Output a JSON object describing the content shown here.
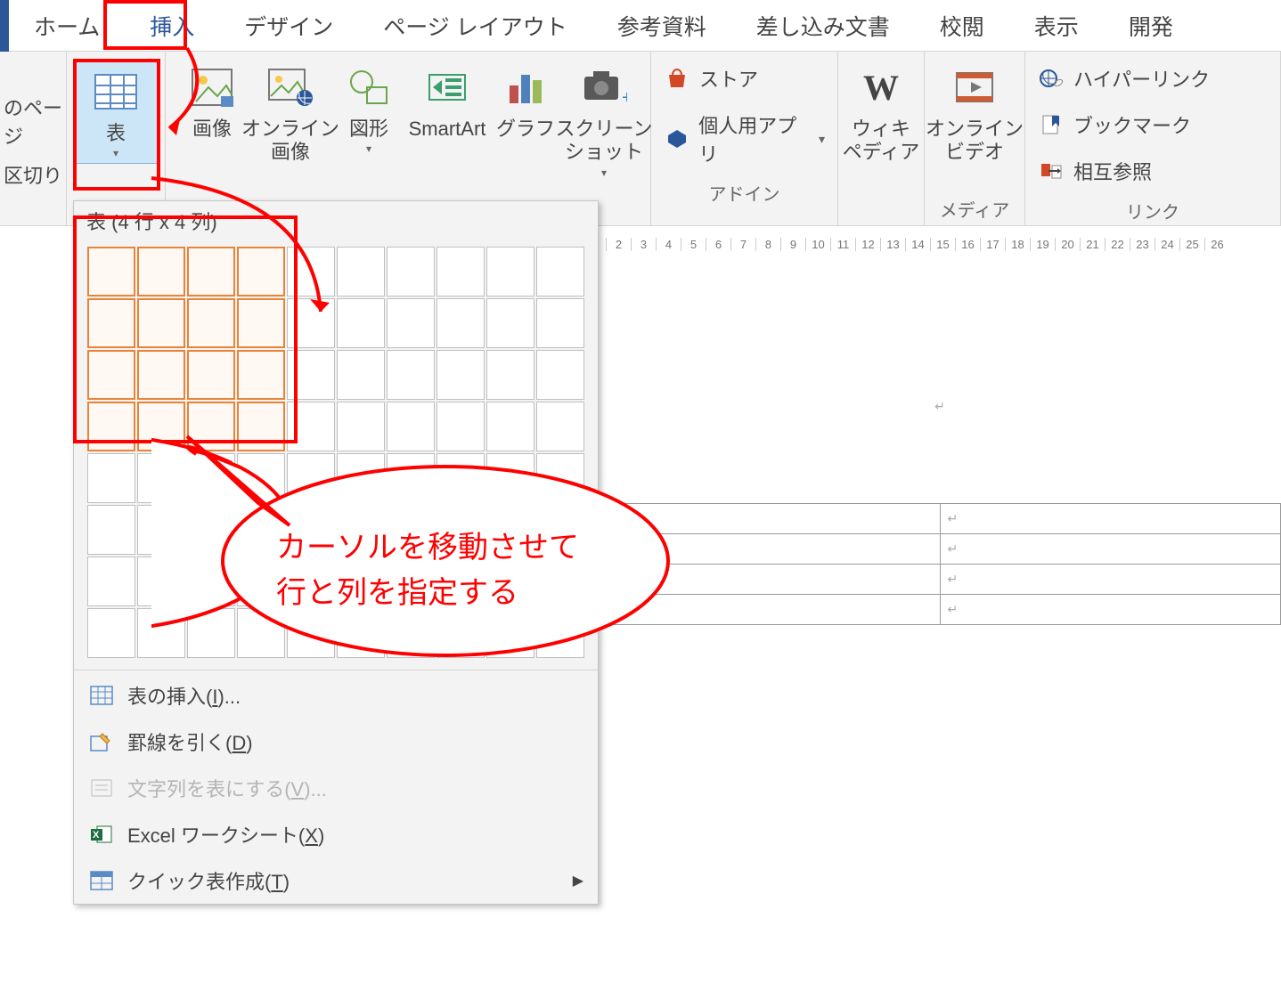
{
  "tabs": {
    "home": "ホーム",
    "insert": "挿入",
    "design": "デザイン",
    "layout": "ページ レイアウト",
    "references": "参考資料",
    "mailings": "差し込み文書",
    "review": "校閲",
    "view": "表示",
    "developer": "開発"
  },
  "ribbon": {
    "pages": {
      "label1": "のページ",
      "label2": "区切り"
    },
    "table": {
      "label": "表"
    },
    "images": {
      "label": "画像"
    },
    "online_images": {
      "label": "オンライン\n画像"
    },
    "shapes": {
      "label": "図形"
    },
    "smartart": {
      "label": "SmartArt"
    },
    "chart": {
      "label": "グラフ"
    },
    "screenshot": {
      "label": "スクリーン\nショット"
    },
    "addins": {
      "store": "ストア",
      "myapps": "個人用アプリ",
      "group": "アドイン"
    },
    "wiki": {
      "label": "ウィキ\nペディア"
    },
    "onlinevideo": {
      "label": "オンライン\nビデオ",
      "group": "メディア"
    },
    "links": {
      "hyperlink": "ハイパーリンク",
      "bookmark": "ブックマーク",
      "crossref": "相互参照",
      "group": "リンク"
    }
  },
  "table_dropdown": {
    "title": "表 (4 行 x 4 列)",
    "rows": 8,
    "cols": 10,
    "hl_rows": 4,
    "hl_cols": 4,
    "menu": {
      "insert": {
        "text": "表の挿入(",
        "key": "I",
        "suffix": ")..."
      },
      "draw": {
        "text": "罫線を引く(",
        "key": "D",
        "suffix": ")"
      },
      "convert": {
        "text": "文字列を表にする(",
        "key": "V",
        "suffix": ")..."
      },
      "excel": {
        "text": "Excel ワークシート(",
        "key": "X",
        "suffix": ")"
      },
      "quick": {
        "text": "クイック表作成(",
        "key": "T",
        "suffix": ")"
      }
    }
  },
  "ruler_ticks": [
    2,
    3,
    4,
    5,
    6,
    7,
    8,
    9,
    10,
    11,
    12,
    13,
    14,
    15,
    16,
    17,
    18,
    19,
    20,
    21,
    22,
    23,
    24,
    25,
    26
  ],
  "preview_table": {
    "rows": 4,
    "cols": 2,
    "cell_mark": "↵"
  },
  "annotation": {
    "callout_line1": "カーソルを移動させて",
    "callout_line2": "行と列を指定する"
  }
}
